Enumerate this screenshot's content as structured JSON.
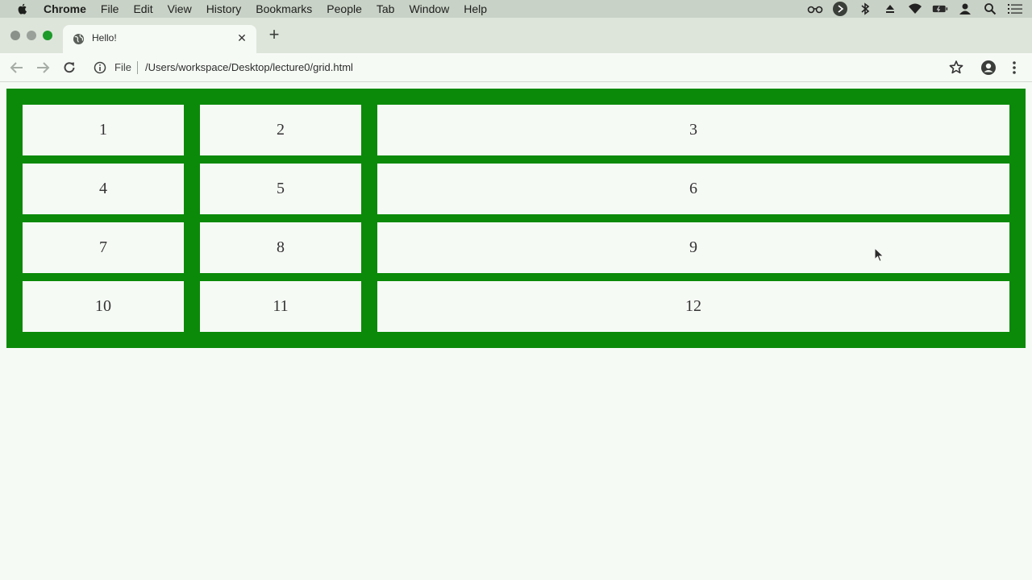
{
  "menubar": {
    "items": [
      "Chrome",
      "File",
      "Edit",
      "View",
      "History",
      "Bookmarks",
      "People",
      "Tab",
      "Window",
      "Help"
    ],
    "status_icons": [
      "glasses-icon",
      "play-circle-icon",
      "bluetooth-icon",
      "eject-icon",
      "wifi-icon",
      "battery-icon",
      "user-icon",
      "search-icon",
      "list-icon"
    ]
  },
  "tab": {
    "title": "Hello!",
    "close_label": "✕",
    "new_tab_label": "+"
  },
  "toolbar": {
    "scheme_label": "File",
    "url": "/Users/workspace/Desktop/lecture0/grid.html"
  },
  "grid": {
    "items": [
      "1",
      "2",
      "3",
      "4",
      "5",
      "6",
      "7",
      "8",
      "9",
      "10",
      "11",
      "12"
    ]
  },
  "colors": {
    "grid_background": "#0b8a09",
    "item_background": "#f6faf5"
  }
}
